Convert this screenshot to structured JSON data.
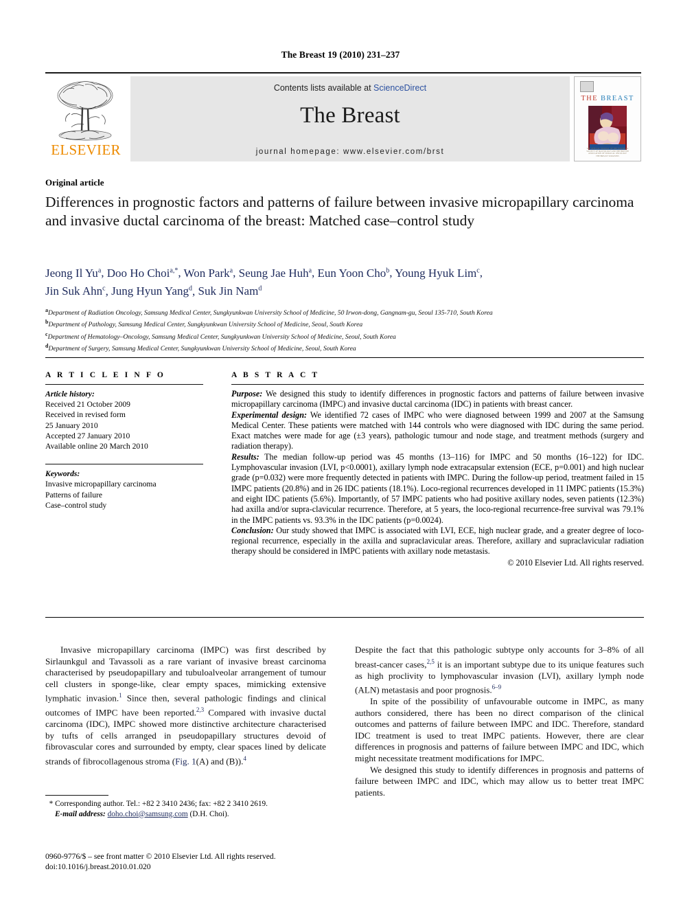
{
  "running_head": "The Breast 19 (2010) 231–237",
  "masthead": {
    "publisher_name": "ELSEVIER",
    "contents_prefix": "Contents lists available at ",
    "contents_link": "ScienceDirect",
    "journal_title": "The Breast",
    "homepage": "journal homepage: www.elsevier.com/brst",
    "cover": {
      "title_part1": "THE",
      "title_part2": "BREAST",
      "footer_line1": "THE OFFICIAL JOURNAL OF THE EUROPEAN",
      "footer_line2": "SOCIETY OF MASTOLOGY AND THE BRITISH",
      "footer_line3": "ASSOCIATION OF SURGICAL ONCOLOGY",
      "footer_line4": "THE BREAST SURGEONS"
    }
  },
  "article": {
    "type": "Original article",
    "title": "Differences in prognostic factors and patterns of failure between invasive micropapillary carcinoma and invasive ductal carcinoma of the breast: Matched case–control study",
    "authors_line1": "Jeong Il Yu ª, Doo Ho Choi ª,*, Won Park ª, Seung Jae Huh ª, Eun Yoon Cho ᵇ, Young Hyuk Lim ᶜ,",
    "authors_line2": "Jin Suk Ahn ᶜ, Jung Hyun Yang ᵈ, Suk Jin Nam ᵈ",
    "authors": [
      {
        "name": "Jeong Il Yu",
        "sup": "a"
      },
      {
        "name": "Doo Ho Choi",
        "sup": "a,*"
      },
      {
        "name": "Won Park",
        "sup": "a"
      },
      {
        "name": "Seung Jae Huh",
        "sup": "a"
      },
      {
        "name": "Eun Yoon Cho",
        "sup": "b"
      },
      {
        "name": "Young Hyuk Lim",
        "sup": "c"
      },
      {
        "name": "Jin Suk Ahn",
        "sup": "c"
      },
      {
        "name": "Jung Hyun Yang",
        "sup": "d"
      },
      {
        "name": "Suk Jin Nam",
        "sup": "d"
      }
    ],
    "affiliations": [
      {
        "sup": "a",
        "text": "Department of Radiation Oncology, Samsung Medical Center, Sungkyunkwan University School of Medicine, 50 Irwon-dong, Gangnam-gu, Seoul 135-710, South Korea"
      },
      {
        "sup": "b",
        "text": "Department of Pathology, Samsung Medical Center, Sungkyunkwan University School of Medicine, Seoul, South Korea"
      },
      {
        "sup": "c",
        "text": "Department of Hematology–Oncology, Samsung Medical Center, Sungkyunkwan University School of Medicine, Seoul, South Korea"
      },
      {
        "sup": "d",
        "text": "Department of Surgery, Samsung Medical Center, Sungkyunkwan University School of Medicine, Seoul, South Korea"
      }
    ]
  },
  "article_info": {
    "heading": "A R T I C L E   I N F O",
    "history_label": "Article history:",
    "history": [
      "Received 21 October 2009",
      "Received in revised form",
      "25 January 2010",
      "Accepted 27 January 2010",
      "Available online 20 March 2010"
    ],
    "keywords_label": "Keywords:",
    "keywords": [
      "Invasive micropapillary carcinoma",
      "Patterns of failure",
      "Case–control study"
    ]
  },
  "abstract": {
    "heading": "A B S T R A C T",
    "sections": [
      {
        "label": "Purpose:",
        "text": " We designed this study to identify differences in prognostic factors and patterns of failure between invasive micropapillary carcinoma (IMPC) and invasive ductal carcinoma (IDC) in patients with breast cancer."
      },
      {
        "label": "Experimental design:",
        "text": " We identified 72 cases of IMPC who were diagnosed between 1999 and 2007 at the Samsung Medical Center. These patients were matched with 144 controls who were diagnosed with IDC during the same period. Exact matches were made for age (±3 years), pathologic tumour and node stage, and treatment methods (surgery and radiation therapy)."
      },
      {
        "label": "Results:",
        "text": " The median follow-up period was 45 months (13–116) for IMPC and 50 months (16–122) for IDC. Lymphovascular invasion (LVI, p<0.0001), axillary lymph node extracapsular extension (ECE, p=0.001) and high nuclear grade (p=0.032) were more frequently detected in patients with IMPC. During the follow-up period, treatment failed in 15 IMPC patients (20.8%) and in 26 IDC patients (18.1%). Loco-regional recurrences developed in 11 IMPC patients (15.3%) and eight IDC patients (5.6%). Importantly, of 57 IMPC patients who had positive axillary nodes, seven patients (12.3%) had axilla and/or supra-clavicular recurrence. Therefore, at 5 years, the loco-regional recurrence-free survival was 79.1% in the IMPC patients vs. 93.3% in the IDC patients (p=0.0024)."
      },
      {
        "label": "Conclusion:",
        "text": " Our study showed that IMPC is associated with LVI, ECE, high nuclear grade, and a greater degree of loco-regional recurrence, especially in the axilla and supraclavicular areas. Therefore, axillary and supraclavicular radiation therapy should be considered in IMPC patients with axillary node metastasis."
      }
    ],
    "copyright": "© 2010 Elsevier Ltd. All rights reserved."
  },
  "body": {
    "left_column": {
      "para1_part1": "Invasive micropapillary carcinoma (IMPC) was first described by Sirlaunkgul and Tavassoli as a rare variant of invasive breast carcinoma characterised by pseudopapillary and tubuloalveolar arrangement of tumour cell clusters in sponge-like, clear empty spaces, mimicking extensive lymphatic invasion.",
      "ref1": "1",
      "para1_part2": " Since then, several pathologic findings and clinical outcomes of IMPC have been reported.",
      "ref2": "2,3",
      "para1_part3": " Compared with invasive ductal carcinoma (IDC), IMPC showed more distinctive architecture characterised by tufts of cells arranged in pseudopapillary structures devoid of fibrovascular cores and surrounded by empty, clear spaces lined by delicate strands of fibrocollagenous stroma (",
      "figlink": "Fig. 1",
      "para1_part4": "(A) and (B)).",
      "ref3": "4"
    },
    "right_column": {
      "para1_part1": "Despite the fact that this pathologic subtype only accounts for 3–8% of all breast-cancer cases,",
      "ref1": "2,5",
      "para1_part2": " it is an important subtype due to its unique features such as high proclivity to lymphovascular invasion (LVI), axillary lymph node (ALN) metastasis and poor prognosis.",
      "ref2": "6–9",
      "para2": "In spite of the possibility of unfavourable outcome in IMPC, as many authors considered, there has been no direct comparison of the clinical outcomes and patterns of failure between IMPC and IDC. Therefore, standard IDC treatment is used to treat IMPC patients. However, there are clear differences in prognosis and patterns of failure between IMPC and IDC, which might necessitate treatment modifications for IMPC.",
      "para3": "We designed this study to identify differences in prognosis and patterns of failure between IMPC and IDC, which may allow us to better treat IMPC patients."
    }
  },
  "footnote": {
    "marker": "*",
    "corresponding": " Corresponding author. Tel.: +82 2 3410 2436; fax: +82 2 3410 2619.",
    "email_label": "E-mail address:",
    "email": "doho.choi@samsung.com",
    "email_suffix": " (D.H. Choi)."
  },
  "imprint": {
    "line1": "0960-9776/$ – see front matter © 2010 Elsevier Ltd. All rights reserved.",
    "line2": "doi:10.1016/j.breast.2010.01.020"
  },
  "colors": {
    "elsevier_orange": "#ED8B00",
    "link_blue": "#2b50a0",
    "author_navy": "#1d2a5c",
    "band_grey": "#e6e6e6"
  }
}
